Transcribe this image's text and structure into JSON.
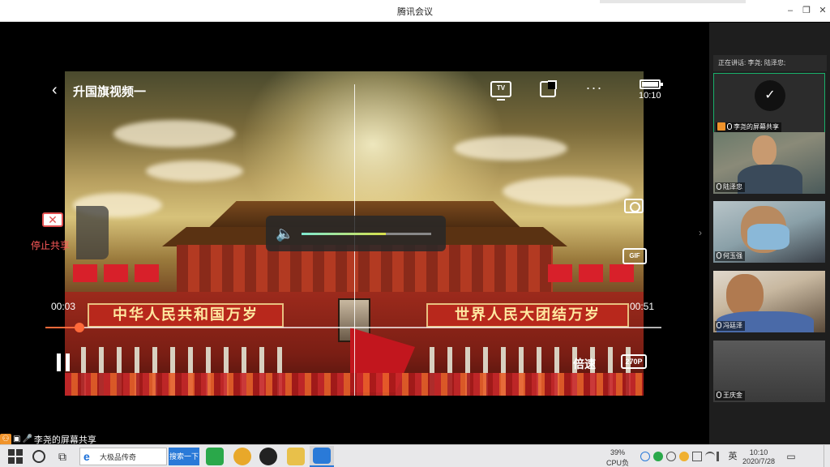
{
  "window": {
    "title": "腾讯会议",
    "minimize_glyph": "–",
    "restore_glyph": "❐",
    "close_glyph": "✕"
  },
  "player": {
    "back_glyph": "‹",
    "video_title": "升国旗视频一",
    "tv_label": "TV",
    "more_glyph": "···",
    "clock": "10:10",
    "gif_label": "GIF",
    "volume_glyph": "🔈",
    "volume_level": 0.65,
    "slogan_left": "中华人民共和国万岁",
    "slogan_right": "世界人民大团结万岁",
    "time_current": "00:03",
    "time_total": "00:51",
    "progress": 0.055,
    "speed_label": "倍速",
    "quality_label": "270P"
  },
  "share": {
    "stop_icon_glyph": "✕",
    "stop_label": "停止共享",
    "sharer_label": "李尧的屏幕共享",
    "sharer_badge": "⚇",
    "sharer_screen_glyph": "▣",
    "sharer_mic_glyph": "🎤"
  },
  "panel": {
    "collapse_glyph": "›",
    "speaking": "正在讲话: 李尧; 陆泽忠;",
    "participants": [
      {
        "name": "李尧的屏幕共享",
        "logo": "✓"
      },
      {
        "name": "陆泽忠"
      },
      {
        "name": "何玉强"
      },
      {
        "name": "冯廷泽"
      },
      {
        "name": "王庆金"
      }
    ]
  },
  "taskbar": {
    "taskview_glyph": "⧉",
    "browser_glyph": "e",
    "browser_text": "大极品传奇",
    "search_button": "搜索一下",
    "cpu_percent": "39%",
    "cpu_label": "CPU负载",
    "ime": "英",
    "time": "10:10",
    "date": "2020/7/28",
    "notification_glyph": "▭"
  },
  "colors": {
    "accent": "#2a7ad8",
    "progress": "#ff6a3a",
    "stop_share": "#ff5a5a",
    "active_border": "#19b06a"
  }
}
